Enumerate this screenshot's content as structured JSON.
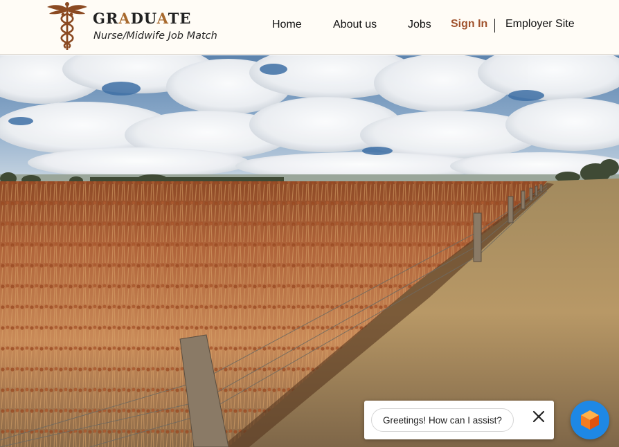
{
  "brand": {
    "title_parts": [
      "GR",
      "A",
      "DU",
      "A",
      "TE"
    ],
    "subtitle": "Nurse/Midwife Job Match",
    "accent_color": "#a86a2e",
    "logo_icon": "caduceus-icon"
  },
  "nav": {
    "home": "Home",
    "about": "About us",
    "jobs": "Jobs",
    "sign_in": "Sign In",
    "employer": "Employer Site",
    "sign_in_color": "#a0522d"
  },
  "hero": {
    "image": "rural-sorghum-field-photo"
  },
  "chat": {
    "greeting": "Greetings! How can I assist?",
    "close_icon": "close-icon",
    "launcher_icon": "chat-cube-icon",
    "launcher_color": "#1e88e5"
  }
}
